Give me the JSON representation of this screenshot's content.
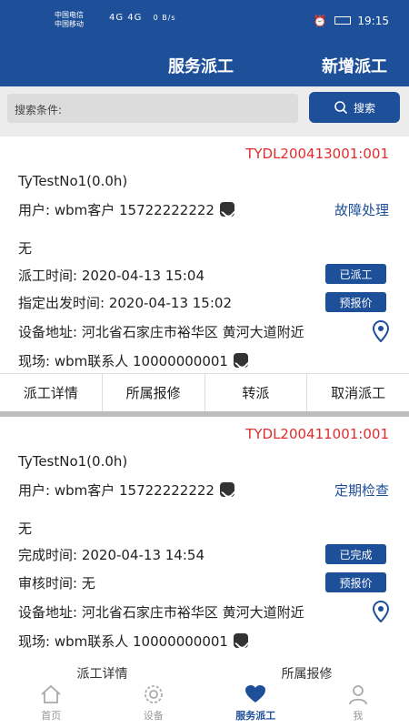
{
  "statusbar": {
    "carrier1": "中国电信",
    "carrier2": "中国移动",
    "net_left": "4G 4G",
    "speed": "0 B/s",
    "time": "19:15"
  },
  "nav": {
    "title": "服务派工",
    "add_label": "新增派工"
  },
  "search": {
    "label": "搜索条件:",
    "button_label": "搜索"
  },
  "orders": [
    {
      "code": "TYDL200413001:001",
      "title": "TyTestNo1(0.0h)",
      "user": "用户: wbm客户 15722222222",
      "service_type": "故障处理",
      "desc": "无",
      "time1": "派工时间: 2020-04-13 15:04",
      "badge1": "已派工",
      "time2": "指定出发时间: 2020-04-13 15:02",
      "badge2": "预报价",
      "address": "设备地址: 河北省石家庄市裕华区 黄河大道附近",
      "contact": "现场: wbm联系人 10000000001",
      "actions": [
        "派工详情",
        "所属报修",
        "转派",
        "取消派工"
      ]
    },
    {
      "code": "TYDL200411001:001",
      "title": "TyTestNo1(0.0h)",
      "user": "用户: wbm客户 15722222222",
      "service_type": "定期检查",
      "desc": "无",
      "time1": "完成时间: 2020-04-13 14:54",
      "badge1": "已完成",
      "time2": "审核时间: 无",
      "badge2": "预报价",
      "address": "设备地址: 河北省石家庄市裕华区 黄河大道附近",
      "contact": "现场: wbm联系人 10000000001",
      "actions": [
        "派工详情",
        "所属报修"
      ]
    }
  ],
  "tabs": [
    {
      "label": "首页",
      "icon": "home-icon"
    },
    {
      "label": "设备",
      "icon": "gear-icon"
    },
    {
      "label": "服务派工",
      "icon": "heart-icon"
    },
    {
      "label": "我",
      "icon": "person-icon"
    }
  ],
  "colors": {
    "primary": "#1e4f99",
    "code_red": "#e22c2c"
  }
}
